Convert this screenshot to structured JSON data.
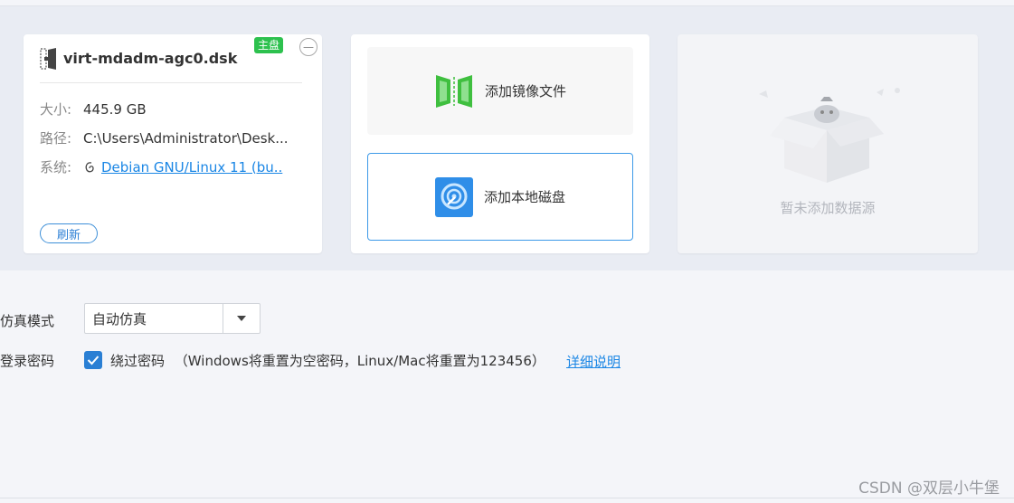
{
  "disk": {
    "name": "virt-mdadm-agc0.dsk",
    "badge": "主盘",
    "close": "—",
    "rows": [
      {
        "label": "大小:",
        "value": "445.9 GB"
      },
      {
        "label": "路径:",
        "value": "C:\\Users\\Administrator\\Desk..."
      },
      {
        "label": "系统:",
        "value": "Debian GNU/Linux 11 (bu.."
      }
    ],
    "refresh": "刷新"
  },
  "add": {
    "image_label": "添加镜像文件",
    "local_label": "添加本地磁盘"
  },
  "empty": {
    "text": "暂未添加数据源"
  },
  "form": {
    "mode_label": "仿真模式",
    "mode_value": "自动仿真",
    "password_label": "登录密码",
    "bypass_label": "绕过密码",
    "bypass_note": "（Windows将重置为空密码，Linux/Mac将重置为123456）",
    "detail_link": "详细说明"
  },
  "watermark": "CSDN @双层小牛堡",
  "colors": {
    "accent": "#2a7fd4",
    "badge_green": "#2dc14e",
    "link": "#1a86e5"
  }
}
